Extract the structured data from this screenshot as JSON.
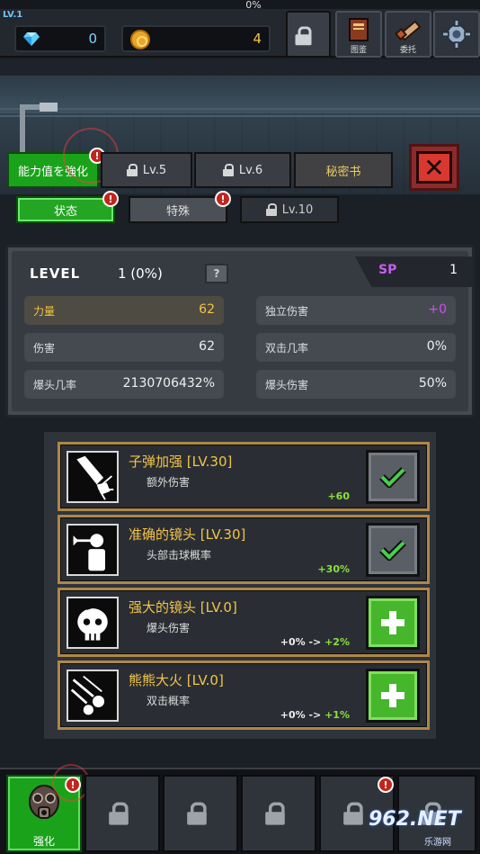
{
  "header": {
    "xp_percent_text": "0%",
    "xp_fraction": 0,
    "level_badge": "LV.1",
    "gems": "0",
    "coins": "4",
    "buttons": [
      {
        "icon": "lock-icon",
        "label": ""
      },
      {
        "icon": "book-icon",
        "label": "图鉴"
      },
      {
        "icon": "scroll-icon",
        "label": "委托"
      },
      {
        "icon": "gear-icon",
        "label": ""
      }
    ]
  },
  "tabs": {
    "strengthen": "能力值を強化",
    "lv5": "Lv.5",
    "lv6": "Lv.6",
    "secret": "秘密书"
  },
  "subtabs": {
    "status": "状态",
    "special": "特殊",
    "lv10": "Lv.10"
  },
  "badge_mark": "!",
  "stats": {
    "level_label": "LEVEL",
    "level_value": "1 (0%)",
    "help": "?",
    "sp_label": "SP",
    "sp_value": "1",
    "left": [
      {
        "label": "力量",
        "value": "62",
        "highlight": true
      },
      {
        "label": "伤害",
        "value": "62",
        "highlight": false
      },
      {
        "label": "爆头几率",
        "value": "2130706432%",
        "highlight": false
      }
    ],
    "right": [
      {
        "label": "独立伤害",
        "value": "+0",
        "value_color": "#d14bf5"
      },
      {
        "label": "双击几率",
        "value": "0%",
        "value_color": "#eeeeee"
      },
      {
        "label": "爆头伤害",
        "value": "50%",
        "value_color": "#eeeeee"
      }
    ]
  },
  "skills": [
    {
      "name": "子弹加强 [LV.30]",
      "desc": "额外伤害",
      "bonus": "+60",
      "bonus_prefix": "",
      "state": "done",
      "icon": "bullet-icon"
    },
    {
      "name": "准确的镜头 [LV.30]",
      "desc": "头部击球概率",
      "bonus": "+30%",
      "bonus_prefix": "",
      "state": "done",
      "icon": "headshot-arrow-icon"
    },
    {
      "name": "强大的镜头 [LV.0]",
      "desc": "爆头伤害",
      "bonus": "+2%",
      "bonus_prefix": "+0% -> ",
      "state": "add",
      "icon": "skull-icon"
    },
    {
      "name": "熊熊大火 [LV.0]",
      "desc": "双击概率",
      "bonus": "+1%",
      "bonus_prefix": "+0% -> ",
      "state": "add",
      "icon": "double-shot-icon"
    }
  ],
  "bottom_nav": {
    "active_label": "强化"
  },
  "watermark": {
    "main": "962.NET",
    "sub": "乐游网"
  },
  "colors": {
    "accent_green": "#1ba21b",
    "gold": "#f2c448",
    "purple": "#c95cf2",
    "alert_red": "#c0261e"
  }
}
